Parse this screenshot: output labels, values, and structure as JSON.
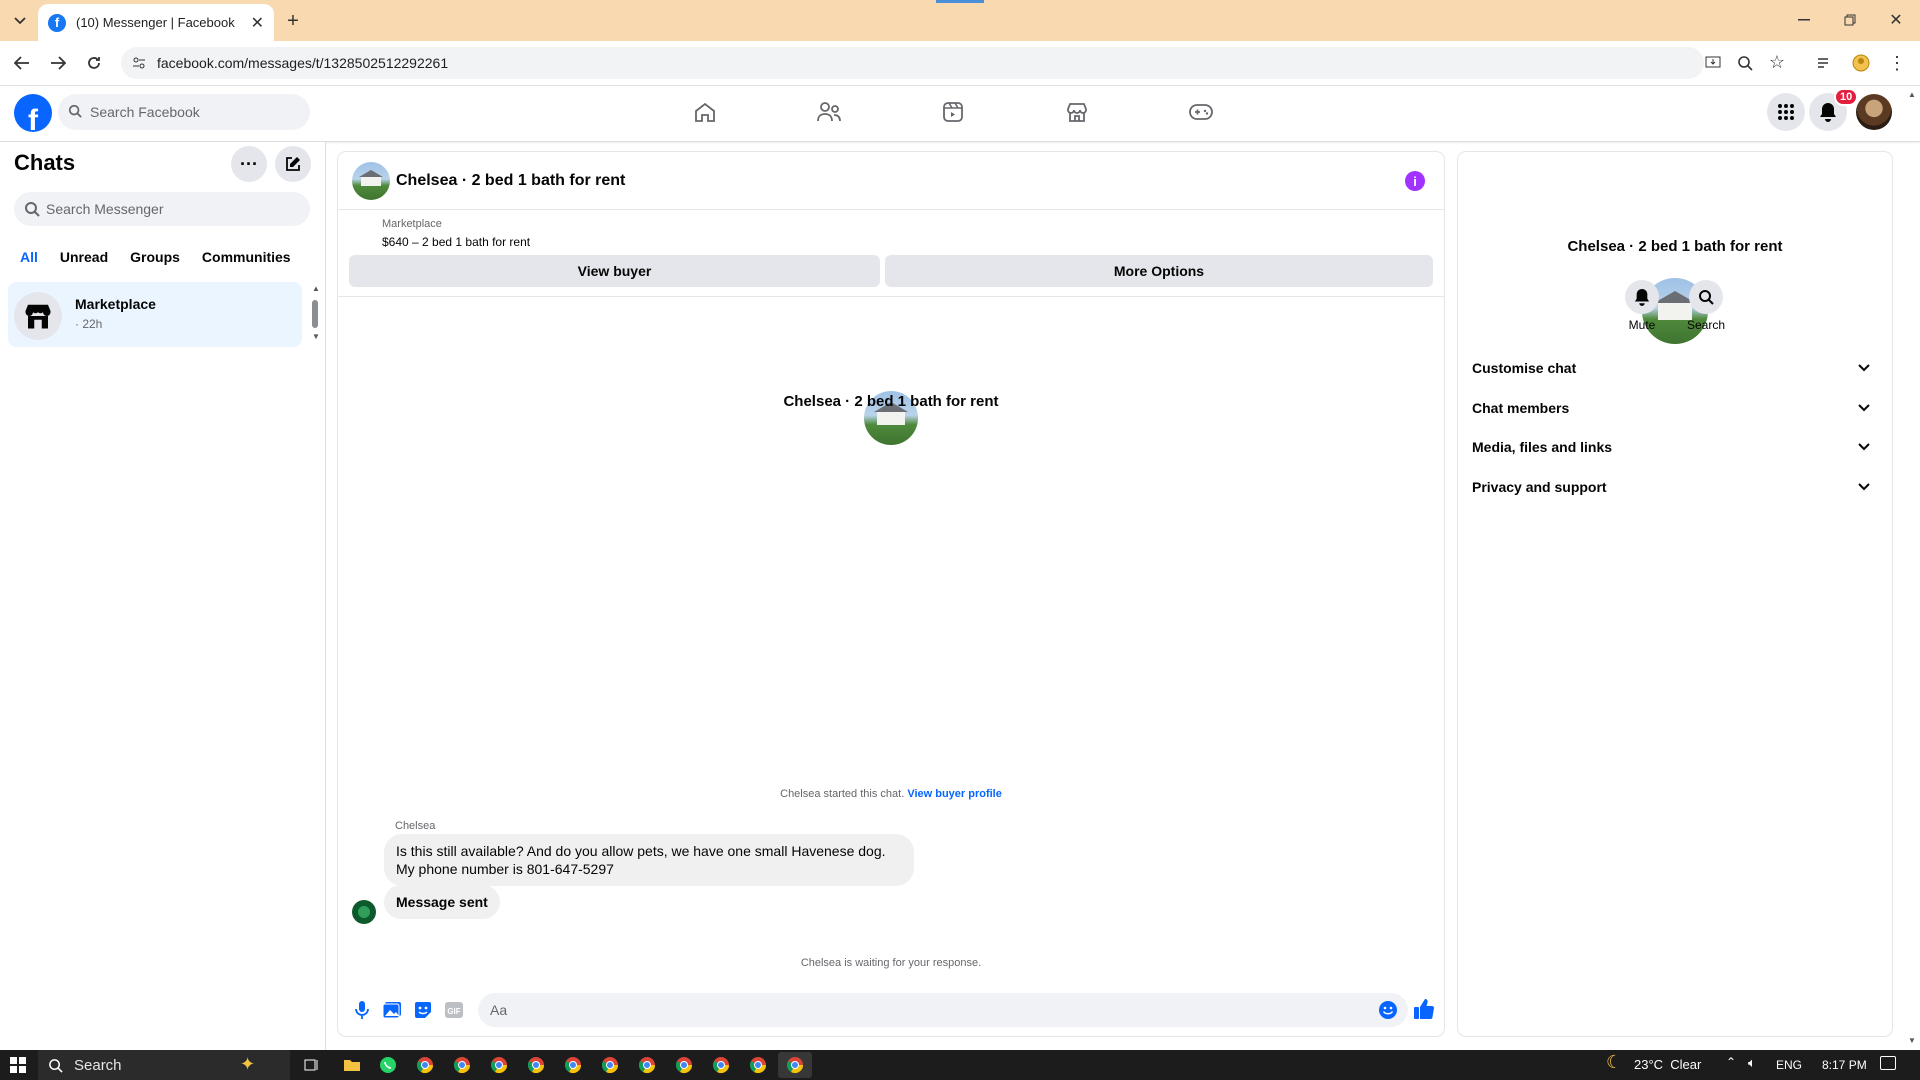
{
  "browser": {
    "tab_title": "(10) Messenger | Facebook",
    "url": "facebook.com/messages/t/1328502512292261"
  },
  "topbar": {
    "search_placeholder": "Search Facebook",
    "notification_count": "10"
  },
  "sidebar": {
    "title": "Chats",
    "search_placeholder": "Search Messenger",
    "filters": [
      "All",
      "Unread",
      "Groups",
      "Communities"
    ],
    "active_filter": "All",
    "chats": [
      {
        "name": "Marketplace",
        "meta": "· 22h"
      }
    ]
  },
  "conversation": {
    "title": "Chelsea · 2 bed 1 bath for rent",
    "listing": {
      "source": "Marketplace",
      "description": "$640 – 2 bed 1 bath for rent"
    },
    "buttons": {
      "view_buyer": "View buyer",
      "more_options": "More Options"
    },
    "intro_name": "Chelsea · 2 bed 1 bath for rent",
    "started_text": "Chelsea started this chat.",
    "started_link": "View buyer profile",
    "sender_name": "Chelsea",
    "messages": [
      "Is this still available? And do you allow pets, we have one small Havenese dog. My phone number is 801-647-5297",
      "Message sent"
    ],
    "waiting_text": "Chelsea is waiting for your response.",
    "composer_placeholder": "Aa"
  },
  "details": {
    "title": "Chelsea · 2 bed 1 bath for rent",
    "actions": [
      "Mute",
      "Search"
    ],
    "sections": [
      "Customise chat",
      "Chat members",
      "Media, files and links",
      "Privacy and support"
    ]
  },
  "taskbar": {
    "search_label": "Search",
    "weather": "23°C  Clear",
    "language": "ENG",
    "time": "8:17 PM"
  }
}
